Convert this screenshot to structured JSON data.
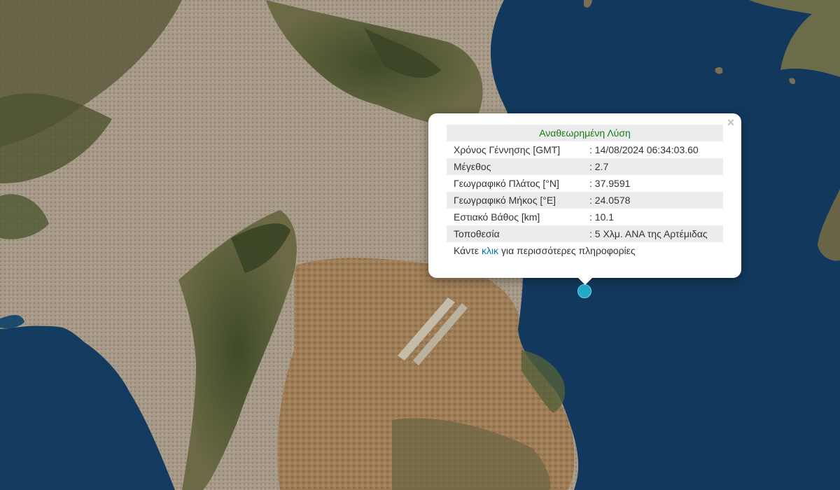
{
  "popup": {
    "title": "Αναθεωρημένη Λύση",
    "close_symbol": "×",
    "rows": [
      {
        "label": "Χρόνος Γέννησης [GMT]",
        "value": ": 14/08/2024 06:34:03.60"
      },
      {
        "label": "Μέγεθος",
        "value": ": 2.7"
      },
      {
        "label": "Γεωγραφικό Πλάτος [°N]",
        "value": ": 37.9591"
      },
      {
        "label": "Γεωγραφικό Μήκος [°E]",
        "value": ": 24.0578"
      },
      {
        "label": "Εστιακό Βάθος [km]",
        "value": ": 10.1"
      },
      {
        "label": "Τοποθεσία",
        "value": ": 5 Χλμ. ΑΝΑ της Αρτέμιδας"
      }
    ],
    "more_prefix": "Κάντε",
    "more_link": "κλικ",
    "more_suffix": "για περισσότερες πληροφορίες"
  },
  "map": {
    "layer": "satellite",
    "sea_color": "#123a5e",
    "urban_color": "#a49682",
    "mountain_color": "#4f5a34",
    "plain_color": "#9c7d58",
    "marker_color": "#22a9c6",
    "marker_icon": "earthquake-epicenter-marker"
  }
}
